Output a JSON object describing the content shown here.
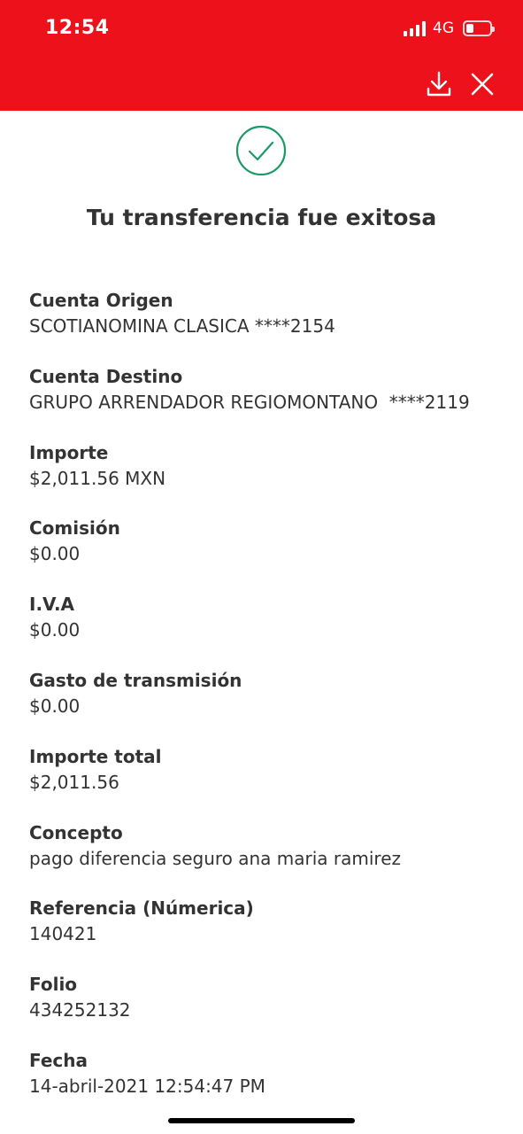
{
  "status_bar": {
    "time": "12:54",
    "network": "4G",
    "battery_level": 0.3
  },
  "header": {
    "background_color": "#ec111a",
    "actions": [
      {
        "icon": "download-icon"
      },
      {
        "icon": "close-icon"
      }
    ]
  },
  "confirmation": {
    "icon": "check-circle-icon",
    "icon_color": "#1a9a66",
    "title": "Tu transferencia fue exitosa"
  },
  "details": [
    {
      "label": "Cuenta Origen",
      "value": "SCOTIANOMINA CLASICA ****2154"
    },
    {
      "label": "Cuenta Destino",
      "value": "GRUPO ARRENDADOR REGIOMONTANO  ****2119"
    },
    {
      "label": "Importe",
      "value": "$2,011.56 MXN"
    },
    {
      "label": "Comisión",
      "value": "$0.00"
    },
    {
      "label": "I.V.A",
      "value": "$0.00"
    },
    {
      "label": "Gasto de transmisión",
      "value": "$0.00"
    },
    {
      "label": "Importe total",
      "value": "$2,011.56"
    },
    {
      "label": "Concepto",
      "value": "pago diferencia seguro ana maria ramirez"
    },
    {
      "label": "Referencia (Númerica)",
      "value": "140421"
    },
    {
      "label": "Folio",
      "value": "434252132"
    },
    {
      "label": "Fecha",
      "value": "14-abril-2021 12:54:47 PM"
    }
  ]
}
